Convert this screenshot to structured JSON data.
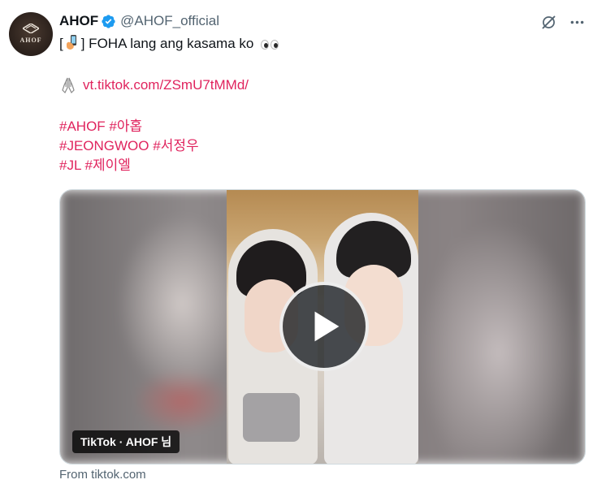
{
  "tweet": {
    "author": {
      "display_name": "AHOF",
      "handle": "@AHOF_official",
      "avatar_text": "AHOF",
      "verified": true,
      "avatar_icon": "ahof-logo-icon"
    },
    "text": {
      "line1_open": "[",
      "line1_close": "] FOHA lang ang kasama ko",
      "line1_emoji": "phone-hand-emoji",
      "line1_end_emoji": "eyes-emoji"
    },
    "link": {
      "icon": "folded-hands-icon",
      "url_text": "vt.tiktok.com/ZSmU7tMMd/"
    },
    "hashtags": [
      [
        "#AHOF",
        "#아홉"
      ],
      [
        "#JEONGWOO",
        "#서정우"
      ],
      [
        "#JL",
        "#제이엘"
      ]
    ],
    "media": {
      "badge": "TikTok · AHOF 님",
      "play_icon": "play-icon"
    },
    "source": "From tiktok.com"
  },
  "actions": {
    "grok_icon": "grok-icon",
    "more_icon": "more-dots-icon"
  },
  "colors": {
    "hashtag": "#e0245e",
    "verified": "#1d9bf0",
    "secondary_text": "#536471"
  }
}
